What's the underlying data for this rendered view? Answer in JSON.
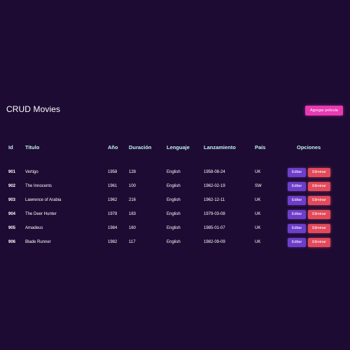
{
  "header": {
    "title": "CRUD Movies",
    "add_label": "Agregar pelicula"
  },
  "colors": {
    "background": "#1e0b33",
    "header_text": "#bff2f0",
    "add_button": "#e83ab1",
    "edit_button": "#6d3ec9",
    "delete_button": "#e24a5b"
  },
  "table": {
    "columns": [
      "Id",
      "Titulo",
      "Año",
      "Duración",
      "Lenguaje",
      "Lanzamiento",
      "País",
      "Opciones"
    ],
    "edit_label": "Editar",
    "delete_label": "Eliminar",
    "rows": [
      {
        "id": "901",
        "title": "Vertigo",
        "year": "1958",
        "duration": "128",
        "language": "English",
        "release": "1958-08-24",
        "country": "UK"
      },
      {
        "id": "902",
        "title": "The Innocents",
        "year": "1961",
        "duration": "100",
        "language": "English",
        "release": "1962-02-19",
        "country": "SW"
      },
      {
        "id": "903",
        "title": "Lawrence of Arabia",
        "year": "1962",
        "duration": "216",
        "language": "English",
        "release": "1962-12-11",
        "country": "UK"
      },
      {
        "id": "904",
        "title": "The Deer Hunter",
        "year": "1978",
        "duration": "183",
        "language": "English",
        "release": "1979-03-08",
        "country": "UK"
      },
      {
        "id": "905",
        "title": "Amadeus",
        "year": "1984",
        "duration": "160",
        "language": "English",
        "release": "1985-01-07",
        "country": "UK"
      },
      {
        "id": "906",
        "title": "Blade Runner",
        "year": "1982",
        "duration": "117",
        "language": "English",
        "release": "1982-09-09",
        "country": "UK"
      }
    ]
  }
}
